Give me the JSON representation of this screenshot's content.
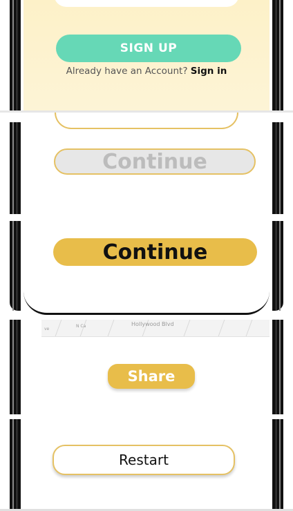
{
  "signup_panel": {
    "signup_button": "SIGN UP",
    "account_prompt": "Already have an Account?",
    "signin_link": "Sign in"
  },
  "continue_disabled_panel": {
    "continue_label": "Continue"
  },
  "continue_active_panel": {
    "continue_label": "Continue"
  },
  "share_panel": {
    "map_street": "Hollywood Blvd",
    "map_label_a": "N Ca",
    "map_label_b": "ve",
    "share_button": "Share"
  },
  "restart_panel": {
    "restart_button": "Restart"
  },
  "colors": {
    "signup_green": "#66d8b6",
    "accent_yellow": "#e8bd4a",
    "outline_yellow": "#e5c163",
    "cream_background": "#fdf1c8",
    "disabled_gray": "#e7e7e7"
  }
}
